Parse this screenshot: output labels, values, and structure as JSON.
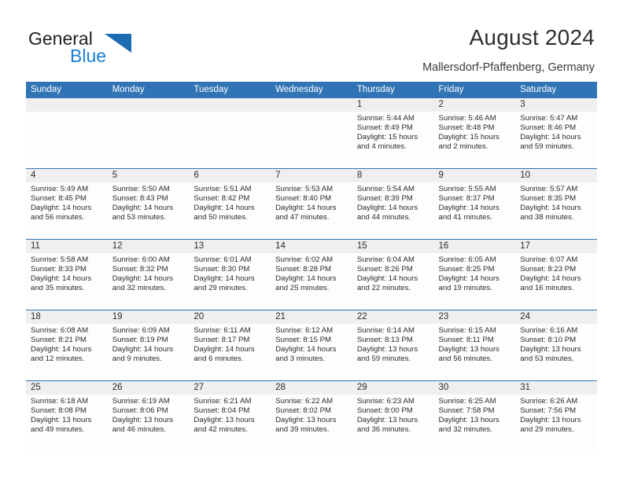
{
  "brand": {
    "name_part1": "General",
    "name_part2": "Blue",
    "accent_color": "#1b7fd4",
    "header_color": "#3174b5"
  },
  "header": {
    "title": "August 2024",
    "subtitle": "Mallersdorf-Pfaffenberg, Germany"
  },
  "calendar": {
    "weekday_headers": [
      "Sunday",
      "Monday",
      "Tuesday",
      "Wednesday",
      "Thursday",
      "Friday",
      "Saturday"
    ],
    "weeks": [
      [
        {
          "day": "",
          "lines": []
        },
        {
          "day": "",
          "lines": []
        },
        {
          "day": "",
          "lines": []
        },
        {
          "day": "",
          "lines": []
        },
        {
          "day": "1",
          "lines": [
            "Sunrise: 5:44 AM",
            "Sunset: 8:49 PM",
            "Daylight: 15 hours",
            "and 4 minutes."
          ]
        },
        {
          "day": "2",
          "lines": [
            "Sunrise: 5:46 AM",
            "Sunset: 8:48 PM",
            "Daylight: 15 hours",
            "and 2 minutes."
          ]
        },
        {
          "day": "3",
          "lines": [
            "Sunrise: 5:47 AM",
            "Sunset: 8:46 PM",
            "Daylight: 14 hours",
            "and 59 minutes."
          ]
        }
      ],
      [
        {
          "day": "4",
          "lines": [
            "Sunrise: 5:49 AM",
            "Sunset: 8:45 PM",
            "Daylight: 14 hours",
            "and 56 minutes."
          ]
        },
        {
          "day": "5",
          "lines": [
            "Sunrise: 5:50 AM",
            "Sunset: 8:43 PM",
            "Daylight: 14 hours",
            "and 53 minutes."
          ]
        },
        {
          "day": "6",
          "lines": [
            "Sunrise: 5:51 AM",
            "Sunset: 8:42 PM",
            "Daylight: 14 hours",
            "and 50 minutes."
          ]
        },
        {
          "day": "7",
          "lines": [
            "Sunrise: 5:53 AM",
            "Sunset: 8:40 PM",
            "Daylight: 14 hours",
            "and 47 minutes."
          ]
        },
        {
          "day": "8",
          "lines": [
            "Sunrise: 5:54 AM",
            "Sunset: 8:39 PM",
            "Daylight: 14 hours",
            "and 44 minutes."
          ]
        },
        {
          "day": "9",
          "lines": [
            "Sunrise: 5:55 AM",
            "Sunset: 8:37 PM",
            "Daylight: 14 hours",
            "and 41 minutes."
          ]
        },
        {
          "day": "10",
          "lines": [
            "Sunrise: 5:57 AM",
            "Sunset: 8:35 PM",
            "Daylight: 14 hours",
            "and 38 minutes."
          ]
        }
      ],
      [
        {
          "day": "11",
          "lines": [
            "Sunrise: 5:58 AM",
            "Sunset: 8:33 PM",
            "Daylight: 14 hours",
            "and 35 minutes."
          ]
        },
        {
          "day": "12",
          "lines": [
            "Sunrise: 6:00 AM",
            "Sunset: 8:32 PM",
            "Daylight: 14 hours",
            "and 32 minutes."
          ]
        },
        {
          "day": "13",
          "lines": [
            "Sunrise: 6:01 AM",
            "Sunset: 8:30 PM",
            "Daylight: 14 hours",
            "and 29 minutes."
          ]
        },
        {
          "day": "14",
          "lines": [
            "Sunrise: 6:02 AM",
            "Sunset: 8:28 PM",
            "Daylight: 14 hours",
            "and 25 minutes."
          ]
        },
        {
          "day": "15",
          "lines": [
            "Sunrise: 6:04 AM",
            "Sunset: 8:26 PM",
            "Daylight: 14 hours",
            "and 22 minutes."
          ]
        },
        {
          "day": "16",
          "lines": [
            "Sunrise: 6:05 AM",
            "Sunset: 8:25 PM",
            "Daylight: 14 hours",
            "and 19 minutes."
          ]
        },
        {
          "day": "17",
          "lines": [
            "Sunrise: 6:07 AM",
            "Sunset: 8:23 PM",
            "Daylight: 14 hours",
            "and 16 minutes."
          ]
        }
      ],
      [
        {
          "day": "18",
          "lines": [
            "Sunrise: 6:08 AM",
            "Sunset: 8:21 PM",
            "Daylight: 14 hours",
            "and 12 minutes."
          ]
        },
        {
          "day": "19",
          "lines": [
            "Sunrise: 6:09 AM",
            "Sunset: 8:19 PM",
            "Daylight: 14 hours",
            "and 9 minutes."
          ]
        },
        {
          "day": "20",
          "lines": [
            "Sunrise: 6:11 AM",
            "Sunset: 8:17 PM",
            "Daylight: 14 hours",
            "and 6 minutes."
          ]
        },
        {
          "day": "21",
          "lines": [
            "Sunrise: 6:12 AM",
            "Sunset: 8:15 PM",
            "Daylight: 14 hours",
            "and 3 minutes."
          ]
        },
        {
          "day": "22",
          "lines": [
            "Sunrise: 6:14 AM",
            "Sunset: 8:13 PM",
            "Daylight: 13 hours",
            "and 59 minutes."
          ]
        },
        {
          "day": "23",
          "lines": [
            "Sunrise: 6:15 AM",
            "Sunset: 8:11 PM",
            "Daylight: 13 hours",
            "and 56 minutes."
          ]
        },
        {
          "day": "24",
          "lines": [
            "Sunrise: 6:16 AM",
            "Sunset: 8:10 PM",
            "Daylight: 13 hours",
            "and 53 minutes."
          ]
        }
      ],
      [
        {
          "day": "25",
          "lines": [
            "Sunrise: 6:18 AM",
            "Sunset: 8:08 PM",
            "Daylight: 13 hours",
            "and 49 minutes."
          ]
        },
        {
          "day": "26",
          "lines": [
            "Sunrise: 6:19 AM",
            "Sunset: 8:06 PM",
            "Daylight: 13 hours",
            "and 46 minutes."
          ]
        },
        {
          "day": "27",
          "lines": [
            "Sunrise: 6:21 AM",
            "Sunset: 8:04 PM",
            "Daylight: 13 hours",
            "and 42 minutes."
          ]
        },
        {
          "day": "28",
          "lines": [
            "Sunrise: 6:22 AM",
            "Sunset: 8:02 PM",
            "Daylight: 13 hours",
            "and 39 minutes."
          ]
        },
        {
          "day": "29",
          "lines": [
            "Sunrise: 6:23 AM",
            "Sunset: 8:00 PM",
            "Daylight: 13 hours",
            "and 36 minutes."
          ]
        },
        {
          "day": "30",
          "lines": [
            "Sunrise: 6:25 AM",
            "Sunset: 7:58 PM",
            "Daylight: 13 hours",
            "and 32 minutes."
          ]
        },
        {
          "day": "31",
          "lines": [
            "Sunrise: 6:26 AM",
            "Sunset: 7:56 PM",
            "Daylight: 13 hours",
            "and 29 minutes."
          ]
        }
      ]
    ]
  }
}
